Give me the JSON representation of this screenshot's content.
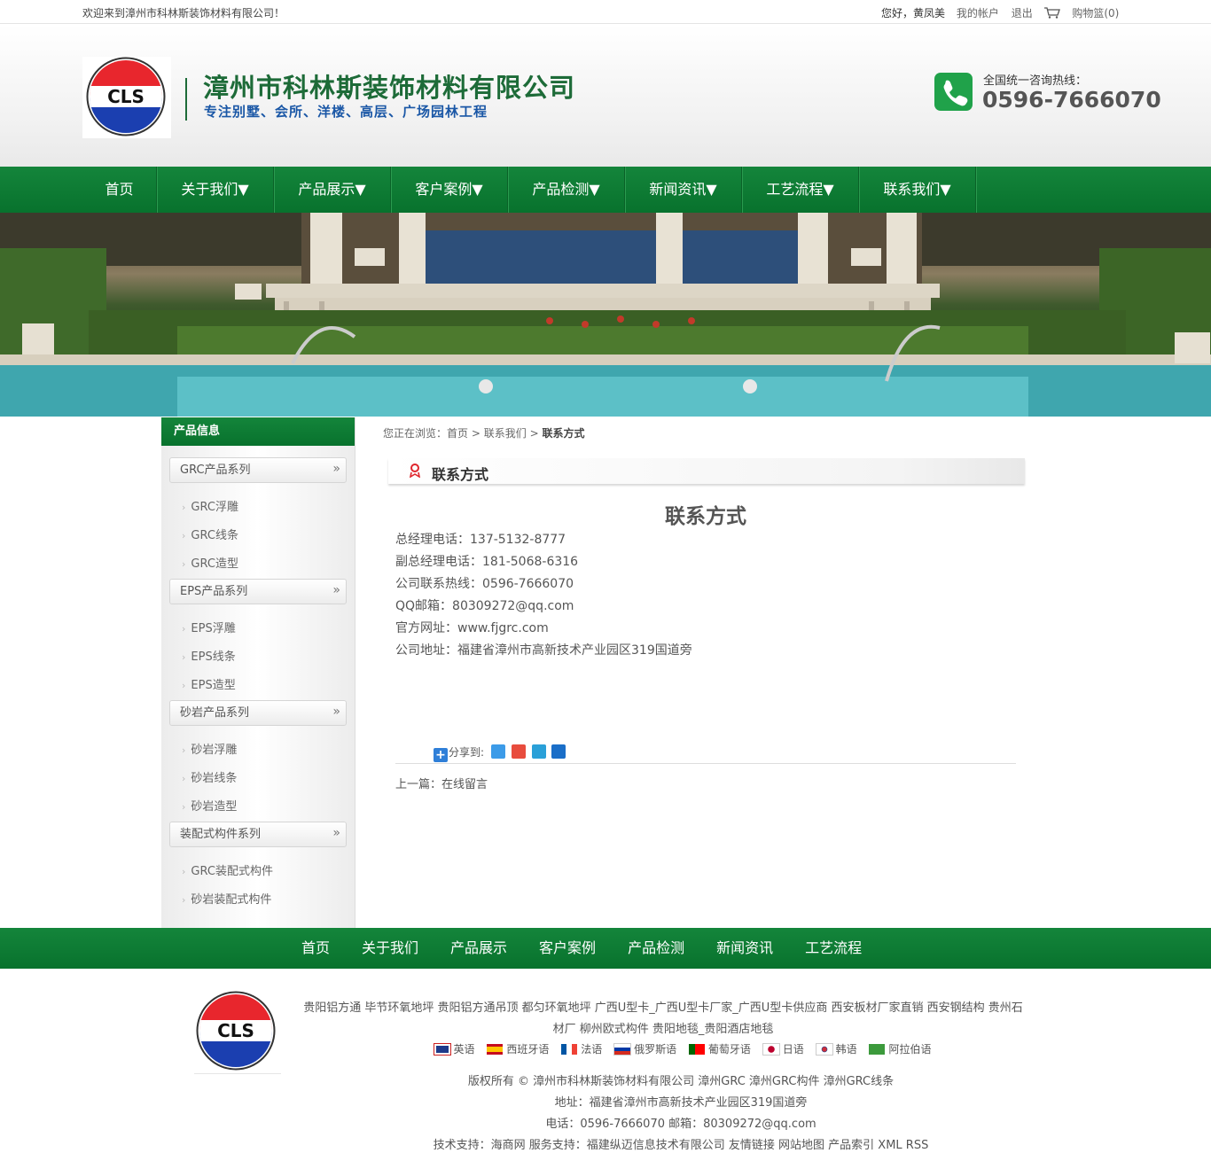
{
  "topbar": {
    "welcome": "欢迎来到漳州市科林斯装饰材料有限公司！",
    "hello": "您好，黄凤美",
    "account": "我的帐户",
    "logout": "退出",
    "cart": "购物篮(0)"
  },
  "header": {
    "logo_text": "CLS",
    "company": "漳州市科林斯装饰材料有限公司",
    "slogan": "专注别墅、会所、洋楼、高层、广场园林工程",
    "hotline_label": "全国统一咨询热线：",
    "hotline": "0596-7666070"
  },
  "nav": [
    "首页",
    "关于我们▼",
    "产品展示▼",
    "客户案例▼",
    "产品检测▼",
    "新闻资讯▼",
    "工艺流程▼",
    "联系我们▼"
  ],
  "sidebar": {
    "title": "产品信息",
    "categories": [
      {
        "label": "GRC产品系列",
        "items": [
          "GRC浮雕",
          "GRC线条",
          "GRC造型"
        ]
      },
      {
        "label": "EPS产品系列",
        "items": [
          "EPS浮雕",
          "EPS线条",
          "EPS造型"
        ]
      },
      {
        "label": "砂岩产品系列",
        "items": [
          "砂岩浮雕",
          "砂岩线条",
          "砂岩造型"
        ]
      },
      {
        "label": "装配式构件系列",
        "items": [
          "GRC装配式构件",
          "砂岩装配式构件"
        ]
      }
    ],
    "arrow": "»"
  },
  "breadcrumb": {
    "prefix": "您正在浏览：",
    "home": "首页",
    "sep": ">",
    "parent": "联系我们",
    "current": "联系方式"
  },
  "content": {
    "section_title": "联系方式",
    "article_title": "联系方式",
    "lines": [
      " 总经理电话：137-5132-8777",
      "副总经理电话：181-5068-6316",
      "公司联系热线：0596-7666070",
      "QQ邮箱：80309272@qq.com",
      "官方网址：www.fjgrc.com",
      "公司地址：福建省漳州市高新技术产业园区319国道旁"
    ],
    "share_label": "分享到:",
    "prev_label": "上一篇：",
    "prev_title": "在线留言"
  },
  "footer": {
    "nav": [
      "首页",
      "关于我们",
      "产品展示",
      "客户案例",
      "产品检测",
      "新闻资讯",
      "工艺流程"
    ],
    "logo_text": "CLS",
    "links": "贵阳铝方通 毕节环氧地坪 贵阳铝方通吊顶 都匀环氧地坪 广西U型卡_广西U型卡厂家_广西U型卡供应商 西安板材厂家直销 西安钢结构 贵州石材厂 柳州欧式构件 贵阳地毯_贵阳酒店地毯",
    "languages": [
      "英语",
      "西班牙语",
      "法语",
      "俄罗斯语",
      "葡萄牙语",
      "日语",
      "韩语",
      "阿拉伯语"
    ],
    "copyright": "版权所有 © 漳州市科林斯装饰材料有限公司 漳州GRC 漳州GRC构件 漳州GRC线条",
    "address": "地址：福建省漳州市高新技术产业园区319国道旁",
    "contact": "电话：0596-7666070 邮箱：80309272@qq.com",
    "support": "技术支持：海商网 服务支持：福建纵迈信息技术有限公司 友情链接 网站地图 产品索引 XML RSS"
  },
  "colors": {
    "green": "#0e7b34",
    "blue": "#1a57a6",
    "logo_red": "#e8262d",
    "logo_blue": "#1b3fb0"
  }
}
